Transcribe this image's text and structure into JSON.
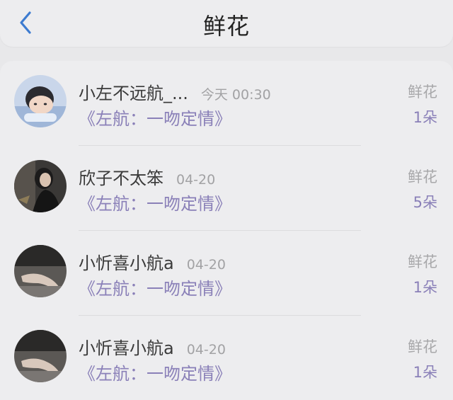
{
  "header": {
    "title": "鲜花",
    "back_icon": "chevron-left-icon",
    "accent_color": "#3d7bd0"
  },
  "records": [
    {
      "name": "小左不远航_...",
      "time": "今天 00:30",
      "gift": "《左航：一吻定情》",
      "type": "鲜花",
      "count": "1朵",
      "avatar": "boy-lying-photo"
    },
    {
      "name": "欣子不太笨",
      "time": "04-20",
      "gift": "《左航：一吻定情》",
      "type": "鲜花",
      "count": "5朵",
      "avatar": "girl-dark-photo"
    },
    {
      "name": "小忻喜小航a",
      "time": "04-20",
      "gift": "《左航：一吻定情》",
      "type": "鲜花",
      "count": "1朵",
      "avatar": "dark-hand-photo"
    },
    {
      "name": "小忻喜小航a",
      "time": "04-20",
      "gift": "《左航：一吻定情》",
      "type": "鲜花",
      "count": "1朵",
      "avatar": "dark-hand-photo"
    }
  ],
  "colors": {
    "gift_text": "#8a80b8",
    "muted": "#a8a8aa"
  }
}
